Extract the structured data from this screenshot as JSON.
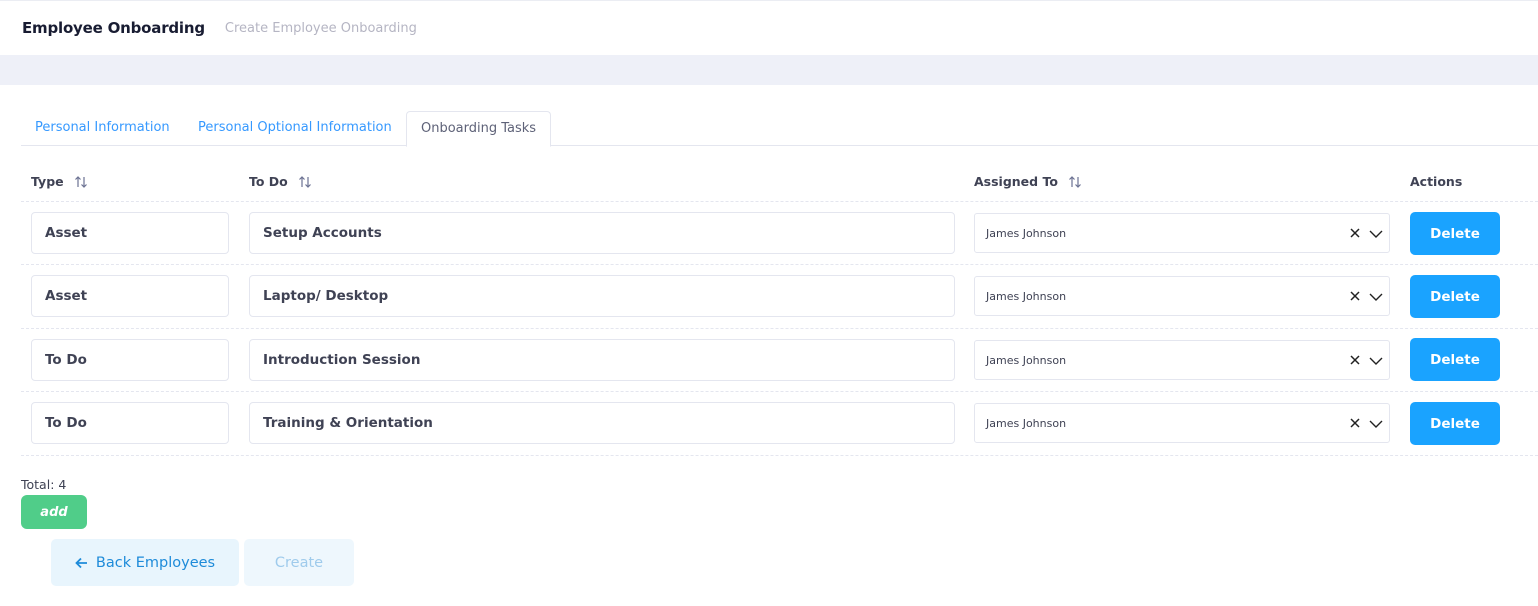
{
  "header": {
    "title": "Employee Onboarding",
    "subtitle": "Create Employee Onboarding"
  },
  "tabs": [
    {
      "label": "Personal Information",
      "active": false
    },
    {
      "label": "Personal Optional Information",
      "active": false
    },
    {
      "label": "Onboarding Tasks",
      "active": true
    }
  ],
  "table": {
    "columns": {
      "type": "Type",
      "todo": "To Do",
      "assigned": "Assigned To",
      "actions": "Actions"
    },
    "rows": [
      {
        "type": "Asset",
        "todo": "Setup Accounts",
        "assigned": "James Johnson",
        "action": "Delete"
      },
      {
        "type": "Asset",
        "todo": "Laptop/ Desktop",
        "assigned": "James Johnson",
        "action": "Delete"
      },
      {
        "type": "To Do",
        "todo": "Introduction Session",
        "assigned": "James Johnson",
        "action": "Delete"
      },
      {
        "type": "To Do",
        "todo": "Training & Orientation",
        "assigned": "James Johnson",
        "action": "Delete"
      }
    ]
  },
  "footer": {
    "total_label": "Total: 4",
    "add_label": "add",
    "back_label": "Back Employees",
    "create_label": "Create"
  },
  "colors": {
    "primary": "#1aa3ff",
    "tab_link": "#3699ff",
    "add_green": "#50cd89",
    "band": "#eef0f8"
  },
  "icons": {
    "sort": "sort-arrows-icon",
    "clear": "close-icon",
    "dropdown": "chevron-down-icon",
    "back": "arrow-left-icon"
  }
}
